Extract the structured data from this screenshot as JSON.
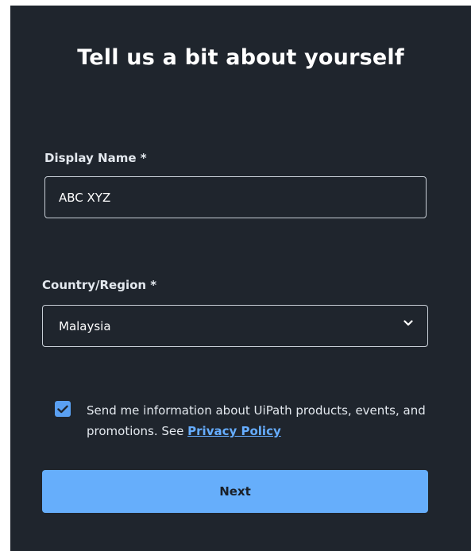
{
  "form": {
    "title": "Tell us a bit about yourself",
    "display_name": {
      "label": "Display Name *",
      "value": "ABC XYZ"
    },
    "country": {
      "label": "Country/Region *",
      "selected": "Malaysia",
      "icon": "chevron-down-icon"
    },
    "consent": {
      "checked": true,
      "text": "Send me information about UiPath products, events, and promotions. See ",
      "link_text": "Privacy Policy"
    },
    "next_label": "Next"
  },
  "colors": {
    "background": "#1f252d",
    "accent": "#66aefb",
    "link": "#66adff",
    "checkbox": "#5aa0f2"
  }
}
